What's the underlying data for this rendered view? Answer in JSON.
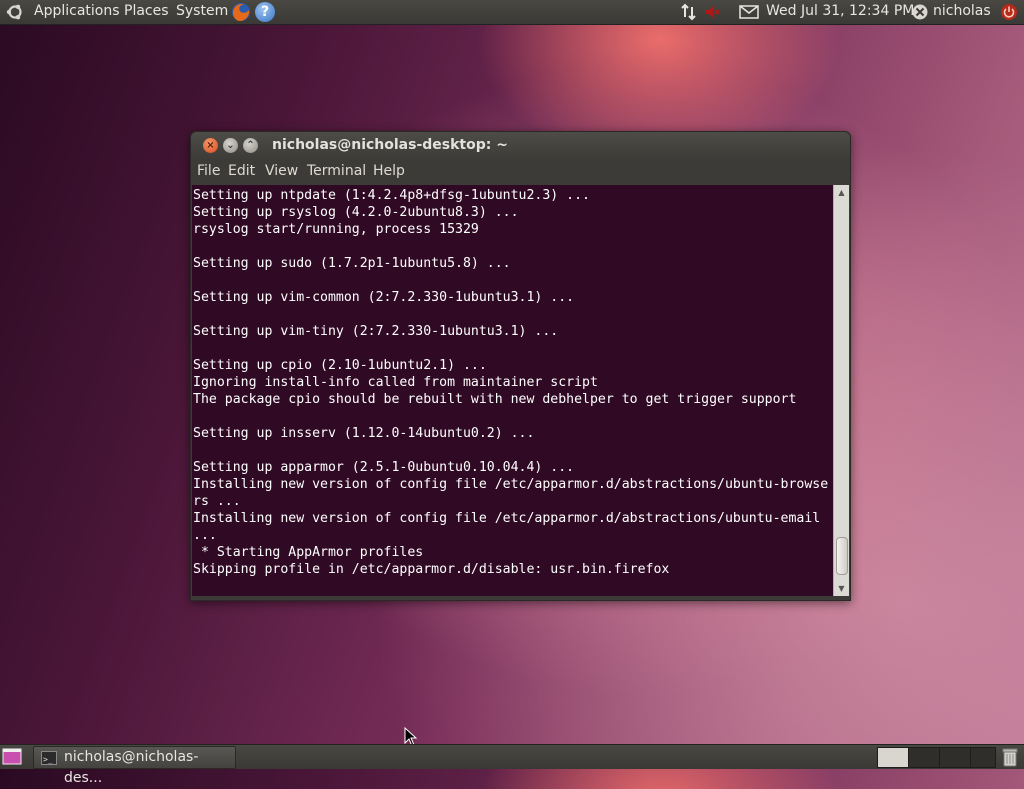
{
  "top_panel": {
    "menus": [
      "Applications",
      "Places",
      "System"
    ],
    "clock": "Wed Jul 31, 12:34 PM",
    "user": "nicholas",
    "icons": [
      "ubuntu-logo",
      "firefox-icon",
      "help-icon",
      "network-icon",
      "volume-icon",
      "mail-icon",
      "user-status-icon",
      "power-icon"
    ]
  },
  "window": {
    "title": "nicholas@nicholas-desktop: ~",
    "menu": [
      "File",
      "Edit",
      "View",
      "Terminal",
      "Help"
    ],
    "lines": [
      "Setting up ntpdate (1:4.2.4p8+dfsg-1ubuntu2.3) ...",
      "Setting up rsyslog (4.2.0-2ubuntu8.3) ...",
      "rsyslog start/running, process 15329",
      "",
      "Setting up sudo (1.7.2p1-1ubuntu5.8) ...",
      "",
      "Setting up vim-common (2:7.2.330-1ubuntu3.1) ...",
      "",
      "Setting up vim-tiny (2:7.2.330-1ubuntu3.1) ...",
      "",
      "Setting up cpio (2.10-1ubuntu2.1) ...",
      "Ignoring install-info called from maintainer script",
      "The package cpio should be rebuilt with new debhelper to get trigger support",
      "",
      "Setting up insserv (1.12.0-14ubuntu0.2) ...",
      "",
      "Setting up apparmor (2.5.1-0ubuntu0.10.04.4) ...",
      "Installing new version of config file /etc/apparmor.d/abstractions/ubuntu-browse",
      "rs ...",
      "Installing new version of config file /etc/apparmor.d/abstractions/ubuntu-email",
      "...",
      " * Starting AppArmor profiles",
      "Skipping profile in /etc/apparmor.d/disable: usr.bin.firefox"
    ]
  },
  "taskbar": {
    "task_label": "nicholas@nicholas-des..."
  },
  "colors": {
    "terminal_bg": "#300a24",
    "panel": "#3c3b37",
    "close_button": "#e0541f"
  }
}
